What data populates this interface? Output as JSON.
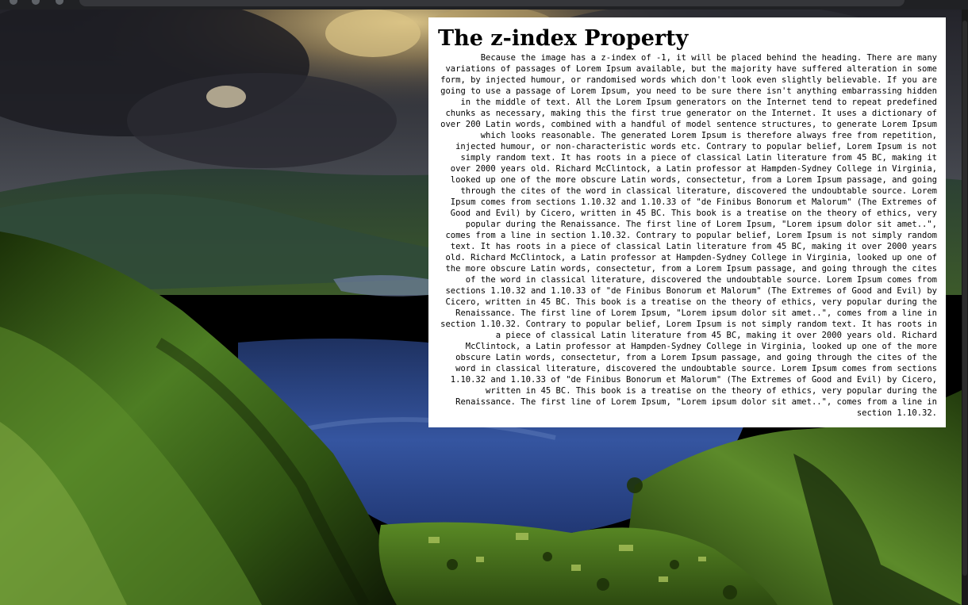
{
  "page": {
    "heading": "The z-index Property",
    "intro": "Because the image has a z-index of -1, it will be placed behind the heading.",
    "paragraph_variations": "There are many variations of passages of Lorem Ipsum available, but the majority have suffered alteration in some form, by injected humour, or randomised words which don't look even slightly believable. If you are going to use a passage of Lorem Ipsum, you need to be sure there isn't anything embarrassing hidden in the middle of text. All the Lorem Ipsum generators on the Internet tend to repeat predefined chunks as necessary, making this the first true generator on the Internet. It uses a dictionary of over 200 Latin words, combined with a handful of model sentence structures, to generate Lorem Ipsum which looks reasonable. The generated Lorem Ipsum is therefore always free from repetition, injected humour, or non-characteristic words etc.",
    "paragraph_origin_1": "Contrary to popular belief, Lorem Ipsum is not simply random text. It has roots in a piece of classical Latin literature from 45 BC, making it over 2000 years old. Richard McClintock, a Latin professor at Hampden-Sydney College in Virginia, looked up one of the more obscure Latin words, consectetur, from a Lorem Ipsum passage, and going through the cites of the word in classical literature, discovered the undoubtable source. Lorem Ipsum comes from sections 1.10.32 and 1.10.33 of \"de Finibus Bonorum et Malorum\" (The Extremes of Good and Evil) by Cicero, written in 45 BC. This book is a treatise on the theory of ethics, very popular during the Renaissance. The first line of Lorem Ipsum, \"Lorem ipsum dolor sit amet..\", comes from a line in section 1.10.32.",
    "paragraph_origin_2": "Contrary to popular belief, Lorem Ipsum is not simply random text. It has roots in a piece of classical Latin literature from 45 BC, making it over 2000 years old. Richard McClintock, a Latin professor at Hampden-Sydney College in Virginia, looked up one of the more obscure Latin words, consectetur, from a Lorem Ipsum passage, and going through the cites of the word in classical literature, discovered the undoubtable source. Lorem Ipsum comes from sections 1.10.32 and 1.10.33 of \"de Finibus Bonorum et Malorum\" (The Extremes of Good and Evil) by Cicero, written in 45 BC. This book is a treatise on the theory of ethics, very popular during the Renaissance. The first line of Lorem Ipsum, \"Lorem ipsum dolor sit amet..\", comes from a line in section 1.10.32.",
    "paragraph_origin_3": "Contrary to popular belief, Lorem Ipsum is not simply random text. It has roots in a piece of classical Latin literature from 45 BC, making it over 2000 years old. Richard McClintock, a Latin professor at Hampden-Sydney College in Virginia, looked up one of the more obscure Latin words, consectetur, from a Lorem Ipsum passage, and going through the cites of the word in classical literature, discovered the undoubtable source. Lorem Ipsum comes from sections 1.10.32 and 1.10.33 of \"de Finibus Bonorum et Malorum\" (The Extremes of Good and Evil) by Cicero, written in 45 BC. This book is a treatise on the theory of ethics, very popular during the Renaissance. The first line of Lorem Ipsum, \"Lorem ipsum dolor sit amet..\", comes from a line in section 1.10.32."
  },
  "background_image": {
    "subject": "mountain-lake-landscape",
    "colors": {
      "sky_dark": "#2a2a30",
      "cloud_light": "#c9b58a",
      "lake": "#2c4a86",
      "hill_green": "#3f6a1f",
      "hill_dark": "#142208"
    }
  },
  "scrollbar": {
    "visible": true
  }
}
